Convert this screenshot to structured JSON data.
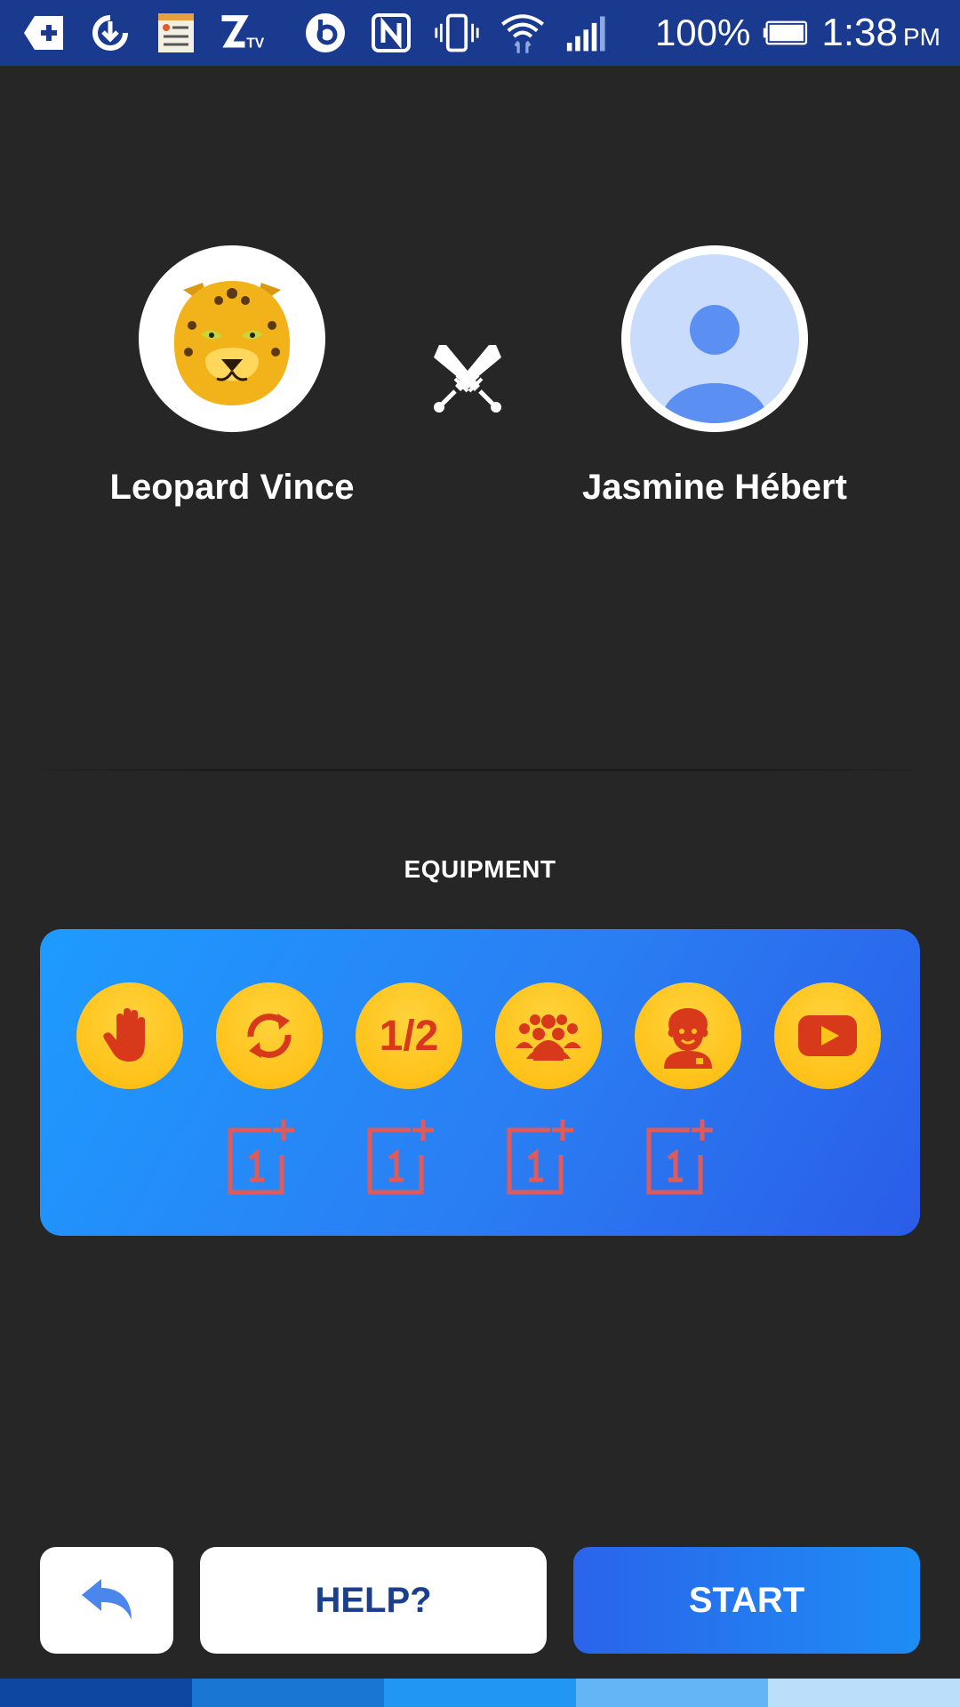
{
  "status_bar": {
    "battery_percent": "100%",
    "time": "1:38",
    "ampm": "PM",
    "app_icons": [
      "add-icon",
      "sync-icon",
      "tasks-icon",
      "ztv-icon",
      "beats-icon",
      "nfc-icon",
      "vibrate-icon",
      "wifi-icon",
      "signal-icon",
      "battery-icon"
    ]
  },
  "players": {
    "player1": {
      "name": "Leopard Vince",
      "avatar": "leopard-avatar"
    },
    "player2": {
      "name": "Jasmine Hébert",
      "avatar": "default-user-avatar"
    }
  },
  "versus_icon": "crossed-swords-icon",
  "equipment": {
    "title": "EQUIPMENT",
    "powerups": [
      {
        "icon": "hand-stop-icon",
        "label": ""
      },
      {
        "icon": "refresh-icon",
        "label": ""
      },
      {
        "icon": "half-icon",
        "label": "1/2"
      },
      {
        "icon": "crowd-icon",
        "label": ""
      },
      {
        "icon": "person-icon",
        "label": ""
      },
      {
        "icon": "youtube-play-icon",
        "label": ""
      }
    ],
    "slots": [
      "plus-one-slot",
      "plus-one-slot",
      "plus-one-slot",
      "plus-one-slot"
    ]
  },
  "buttons": {
    "back_icon": "reply-arrow-icon",
    "help_label": "HELP?",
    "start_label": "START"
  },
  "colors": {
    "background": "#262626",
    "status_bar": "#1a3a8f",
    "powerup_yellow": "#ffc21a",
    "powerup_red": "#d9391b",
    "start_blue": "#2a64ea",
    "help_text": "#1b3f8c",
    "bottom_strip": [
      "#0d47a1",
      "#1976d2",
      "#2196f3",
      "#64b5f6",
      "#bbdefb"
    ]
  }
}
